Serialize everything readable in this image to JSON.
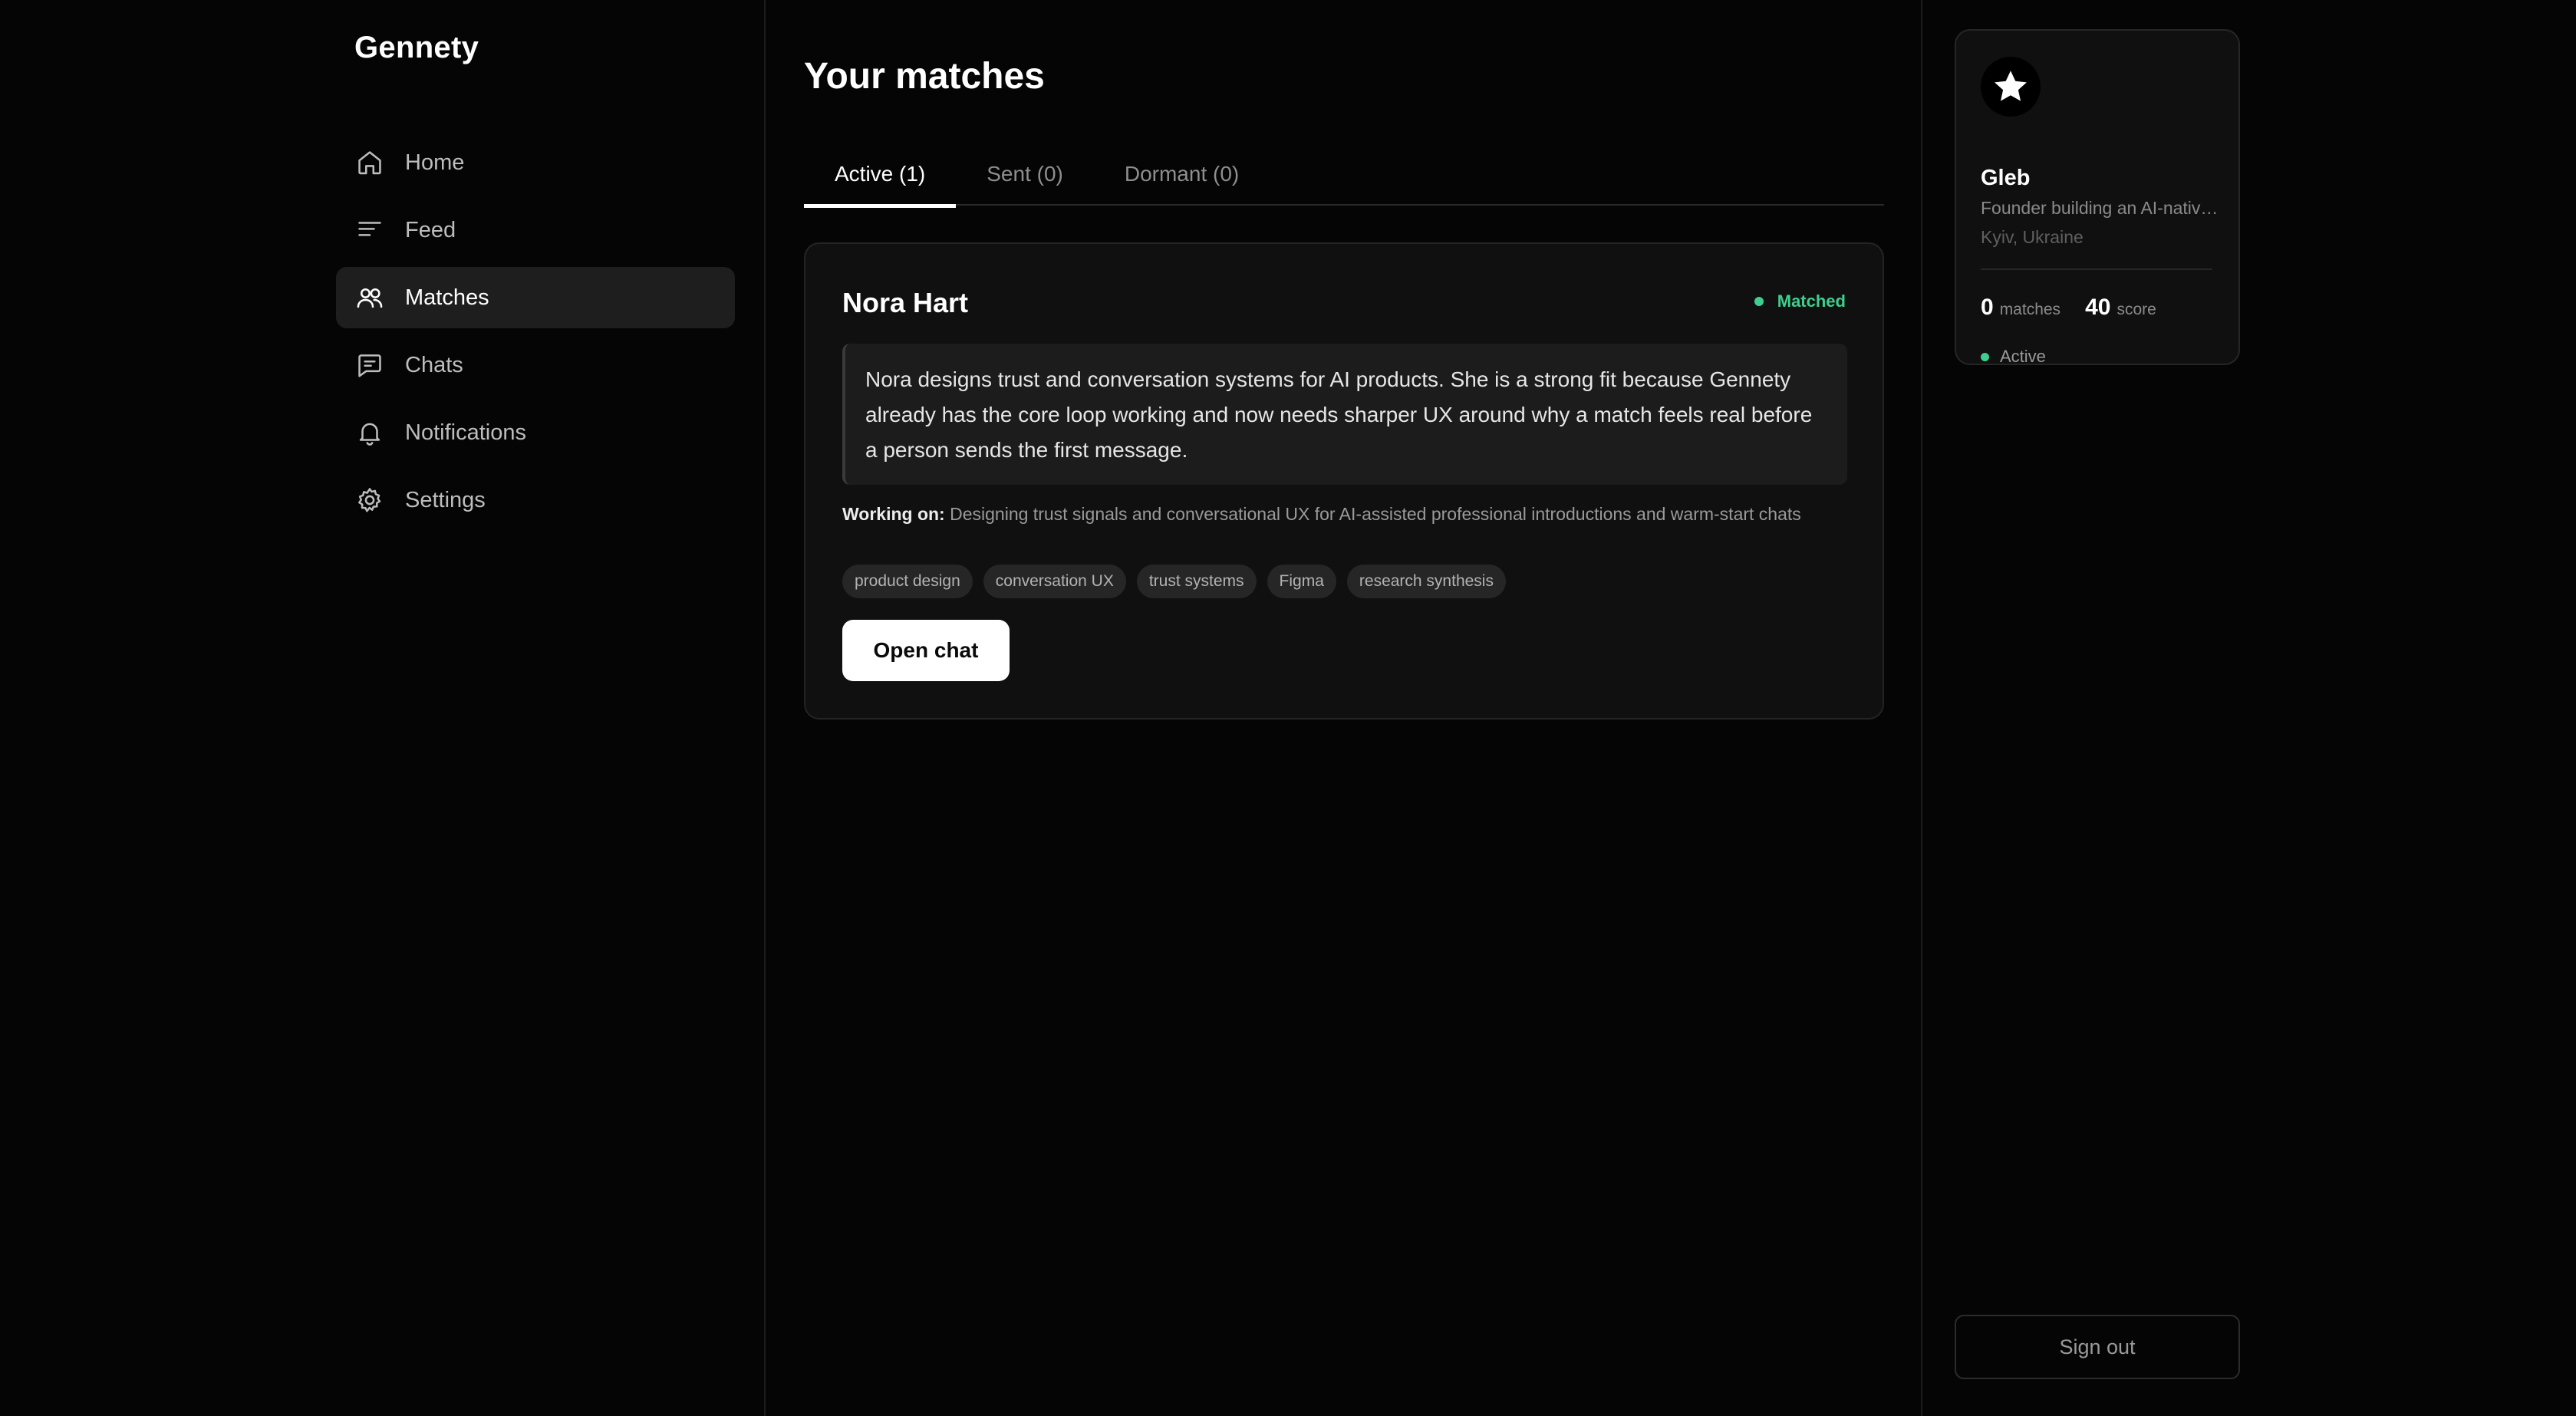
{
  "app": {
    "name": "Gennety"
  },
  "sidebar": {
    "items": [
      {
        "label": "Home",
        "icon": "home-icon",
        "active": false
      },
      {
        "label": "Feed",
        "icon": "feed-icon",
        "active": false
      },
      {
        "label": "Matches",
        "icon": "matches-icon",
        "active": true
      },
      {
        "label": "Chats",
        "icon": "chat-icon",
        "active": false
      },
      {
        "label": "Notifications",
        "icon": "bell-icon",
        "active": false
      },
      {
        "label": "Settings",
        "icon": "gear-icon",
        "active": false
      }
    ]
  },
  "main": {
    "title": "Your matches",
    "tabs": [
      {
        "label": "Active (1)",
        "active": true
      },
      {
        "label": "Sent (0)",
        "active": false
      },
      {
        "label": "Dormant (0)",
        "active": false
      }
    ],
    "match": {
      "name": "Nora Hart",
      "status": "Matched",
      "reason": "Nora designs trust and conversation systems for AI products. She is a strong fit because Gennety already has the core loop working and now needs sharper UX around why a match feels real before a person sends the first message.",
      "working_on_label": "Working on:",
      "working_on": "Designing trust signals and conversational UX for AI-assisted professional introductions and warm-start chats",
      "tags": [
        "product design",
        "conversation UX",
        "trust systems",
        "Figma",
        "research synthesis"
      ],
      "action_label": "Open chat"
    }
  },
  "profile": {
    "avatar_icon": "star-icon",
    "name": "Gleb",
    "bio": "Founder building an AI-native professional network",
    "location": "Kyiv, Ukraine",
    "matches_count": "0",
    "matches_label": "matches",
    "score": "40",
    "score_label": "score",
    "status": "Active"
  },
  "sign_out_label": "Sign out",
  "colors": {
    "background": "#050505",
    "card": "#101010",
    "accent_green": "#3ecf8e",
    "text_primary": "#ffffff",
    "text_muted": "#8a8a8a"
  }
}
